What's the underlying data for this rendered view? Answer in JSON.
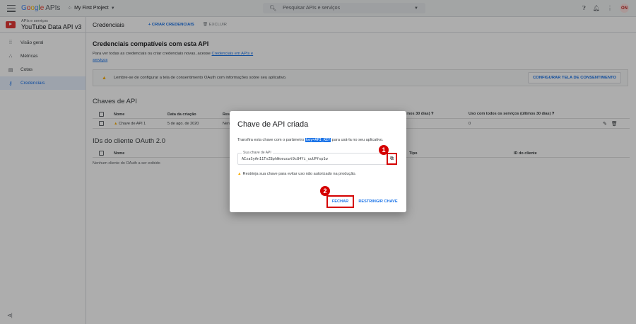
{
  "topbar": {
    "brand": "Google APIs",
    "project": "My First Project",
    "search_placeholder": "Pesquisar APIs e serviços",
    "avatar_initials": "ON"
  },
  "sidebar": {
    "api_subtitle": "APIs e serviços",
    "api_name": "YouTube Data API v3",
    "items": [
      {
        "label": "Visão geral",
        "icon": "dashboard-icon"
      },
      {
        "label": "Métricas",
        "icon": "metrics-icon"
      },
      {
        "label": "Cotas",
        "icon": "quota-icon"
      },
      {
        "label": "Credenciais",
        "icon": "key-icon",
        "active": true
      }
    ],
    "collapse_icon": "collapse-sidebar-icon"
  },
  "header": {
    "title": "Credenciais",
    "create_label": "+ CRIAR CREDENCIAIS",
    "delete_label": "EXCLUIR"
  },
  "main": {
    "heading": "Credenciais compatíveis com esta API",
    "desc_text": "Para ver todas as credenciais ou criar credenciais novas, acesse ",
    "desc_link": "Credenciais em APIs e serviços",
    "banner_text": "Lembre-se de configurar a tela de consentimento OAuth com informações sobre seu aplicativo.",
    "banner_button": "CONFIGURAR TELA DE CONSENTIMENTO",
    "api_keys": {
      "title": "Chaves de API",
      "columns": [
        "Nome",
        "Data da criação",
        "Res",
        "últimos 30 dias)",
        "Uso com todos os serviços (últimos 30 dias)"
      ],
      "rows": [
        {
          "name": "Chave de API 1",
          "date": "5 de ago. de 2020",
          "restr": "Nen",
          "usage": "0"
        }
      ]
    },
    "oauth": {
      "title": "IDs do cliente OAuth 2.0",
      "columns": [
        "Nome",
        "Tipo",
        "ID do cliente"
      ],
      "empty": "Nenhum cliente do OAuth a ser exibido"
    }
  },
  "dialog": {
    "title": "Chave de API criada",
    "text_before": "Transfira esta chave com o parâmetro ",
    "param": "key=API_KEY",
    "text_after": " para usá-la no seu aplicativo.",
    "key_label": "Sua chave de API",
    "key_value": "AIzaSyAn11TxZ8phWoeucwt9c84Yi_uuUPfsp1w",
    "warning": "Restrinja sua chave para evitar uso não autorizado na produção.",
    "close_label": "FECHAR",
    "restrict_label": "RESTRINGIR CHAVE"
  },
  "markers": [
    "1",
    "2"
  ]
}
